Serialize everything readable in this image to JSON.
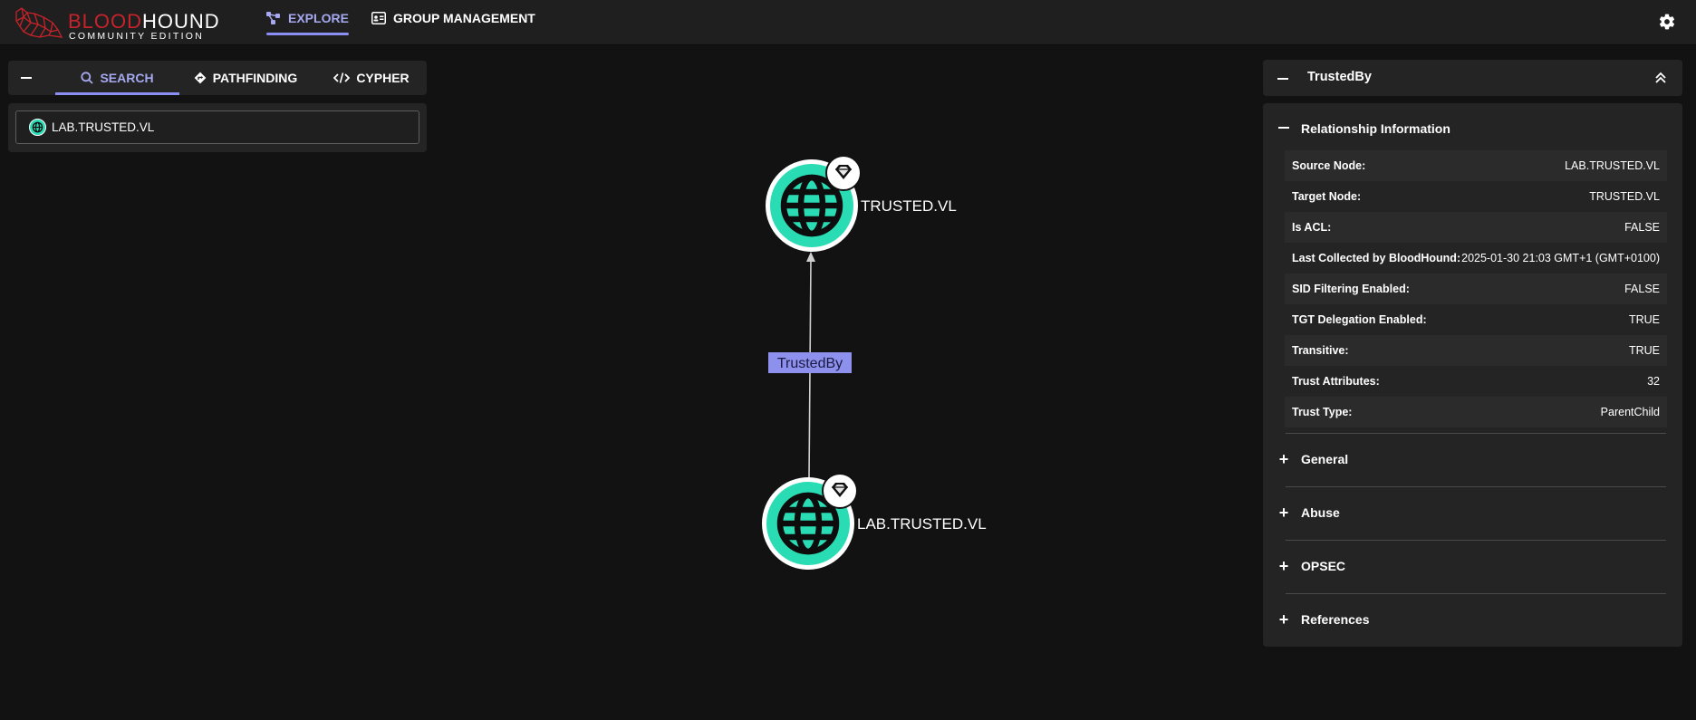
{
  "app": {
    "logo_word1": "BLOOD",
    "logo_word2": "HOUND",
    "logo_subtitle": "COMMUNITY EDITION",
    "brand_color": "#c6232a",
    "accent_color": "#8b8ef2"
  },
  "nav": {
    "explore": "EXPLORE",
    "group_management": "GROUP MANAGEMENT",
    "settings_icon": "gear-icon"
  },
  "explore_tabs": {
    "search": "SEARCH",
    "pathfinding": "PATHFINDING",
    "cypher": "CYPHER",
    "active": "SEARCH"
  },
  "search": {
    "value": "LAB.TRUSTED.VL",
    "chip_icon": "globe-icon"
  },
  "graph": {
    "nodes": [
      {
        "label": "TRUSTED.VL",
        "type": "Domain",
        "icon": "globe-icon",
        "badge": "gem-icon"
      },
      {
        "label": "LAB.TRUSTED.VL",
        "type": "Domain",
        "icon": "globe-icon",
        "badge": "gem-icon"
      }
    ],
    "edge": {
      "label": "TrustedBy",
      "source": "LAB.TRUSTED.VL",
      "target": "TRUSTED.VL"
    },
    "node_color": "#2adcb4",
    "edge_label_color": "#8e90ee"
  },
  "details": {
    "title": "TrustedBy",
    "relationship_section": "Relationship Information",
    "properties": [
      {
        "key": "Source Node:",
        "value": "LAB.TRUSTED.VL"
      },
      {
        "key": "Target Node:",
        "value": "TRUSTED.VL"
      },
      {
        "key": "Is ACL:",
        "value": "FALSE"
      },
      {
        "key": "Last Collected by BloodHound:",
        "value": "2025-01-30 21:03 GMT+1 (GMT+0100)"
      },
      {
        "key": "SID Filtering Enabled:",
        "value": "FALSE"
      },
      {
        "key": "TGT Delegation Enabled:",
        "value": "TRUE"
      },
      {
        "key": "Transitive:",
        "value": "TRUE"
      },
      {
        "key": "Trust Attributes:",
        "value": "32"
      },
      {
        "key": "Trust Type:",
        "value": "ParentChild"
      }
    ],
    "sections": [
      {
        "label": "General"
      },
      {
        "label": "Abuse"
      },
      {
        "label": "OPSEC"
      },
      {
        "label": "References"
      }
    ]
  }
}
